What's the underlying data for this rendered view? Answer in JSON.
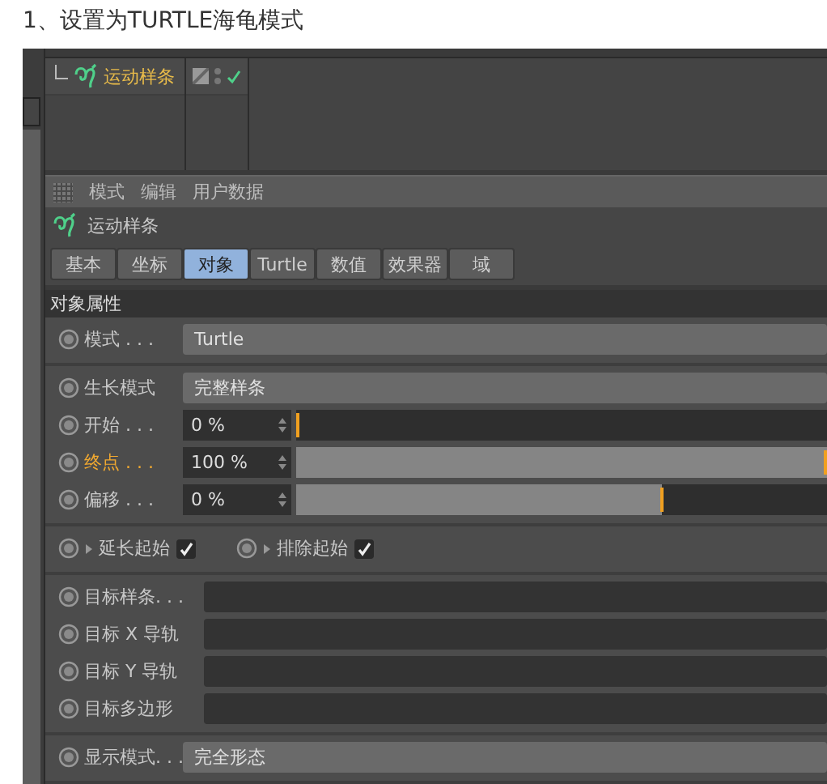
{
  "caption": "1、设置为TURTLE海龟模式",
  "object_manager": {
    "objects": [
      {
        "name": "运动样条",
        "selected": true,
        "enabled": true
      }
    ]
  },
  "attribute_manager": {
    "menu": [
      "模式",
      "编辑",
      "用户数据"
    ],
    "object_name": "运动样条",
    "tabs": [
      {
        "label": "基本",
        "selected": false
      },
      {
        "label": "坐标",
        "selected": false
      },
      {
        "label": "对象",
        "selected": true
      },
      {
        "label": "Turtle",
        "selected": false
      },
      {
        "label": "数值",
        "selected": false
      },
      {
        "label": "效果器",
        "selected": false
      },
      {
        "label": "域",
        "selected": false
      }
    ],
    "section": "对象属性",
    "groups": [
      [
        {
          "kind": "dropdown",
          "label": "模式 . . .",
          "value": "Turtle",
          "highlighted": false
        }
      ],
      [
        {
          "kind": "dropdown",
          "label": "生长模式",
          "value": "完整样条",
          "highlighted": false
        },
        {
          "kind": "slider",
          "label": "开始 . . .",
          "value": "0 %",
          "level": 0,
          "highlighted": false
        },
        {
          "kind": "slider",
          "label": "终点 . . .",
          "value": "100 %",
          "level": 1,
          "highlighted": true
        },
        {
          "kind": "slider",
          "label": "偏移 . . .",
          "value": "0 %",
          "level": 0.69,
          "highlighted": false
        }
      ],
      [
        {
          "kind": "checks",
          "items": [
            {
              "label": "延长起始",
              "checked": true
            },
            {
              "label": "排除起始",
              "checked": true
            }
          ]
        }
      ],
      [
        {
          "kind": "link",
          "label": "目标样条. . .",
          "highlighted": false
        },
        {
          "kind": "link",
          "label": "目标 X 导轨",
          "highlighted": false
        },
        {
          "kind": "link",
          "label": "目标 Y 导轨",
          "highlighted": false
        },
        {
          "kind": "link",
          "label": "目标多边形",
          "highlighted": false
        }
      ],
      [
        {
          "kind": "dropdown",
          "label": "显示模式. . .",
          "value": "完全形态",
          "highlighted": false
        }
      ]
    ]
  }
}
